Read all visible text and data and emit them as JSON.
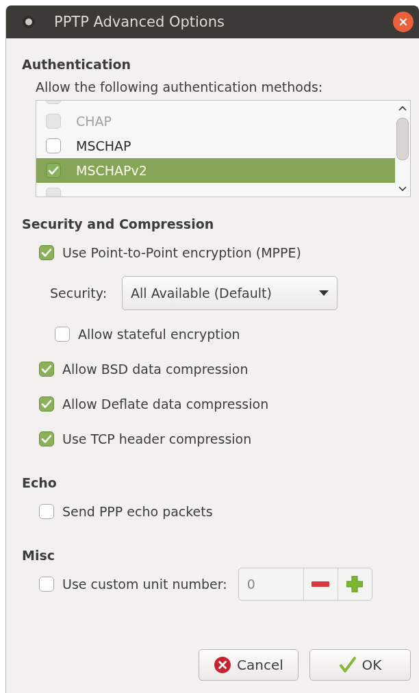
{
  "window": {
    "title": "PPTP Advanced Options"
  },
  "authentication": {
    "heading": "Authentication",
    "prompt": "Allow the following authentication methods:",
    "methods": [
      {
        "checked": false,
        "disabled": true,
        "selected": false
      },
      {
        "label": "CHAP",
        "checked": false,
        "disabled": true,
        "selected": false
      },
      {
        "label": "MSCHAP",
        "checked": false,
        "disabled": false,
        "selected": false
      },
      {
        "label": "MSCHAPv2",
        "checked": true,
        "disabled": false,
        "selected": true
      },
      {
        "checked": false,
        "disabled": true,
        "selected": false
      }
    ]
  },
  "sections": [
    {
      "heading": "Security and Compression",
      "items": [
        {
          "kind": "checkbox",
          "label": "Use Point-to-Point encryption (MPPE)",
          "checked": true,
          "children": [
            {
              "kind": "dropdown",
              "label": "Security:",
              "value": "All Available (Default)"
            },
            {
              "kind": "checkbox",
              "label": "Allow stateful encryption",
              "checked": false
            }
          ]
        },
        {
          "kind": "checkbox",
          "label": "Allow BSD data compression",
          "checked": true
        },
        {
          "kind": "checkbox",
          "label": "Allow Deflate data compression",
          "checked": true
        },
        {
          "kind": "checkbox",
          "label": "Use TCP header compression",
          "checked": true
        }
      ]
    },
    {
      "heading": "Echo",
      "items": [
        {
          "kind": "checkbox",
          "label": "Send PPP echo packets",
          "checked": false
        }
      ]
    },
    {
      "heading": "Misc",
      "items": [
        {
          "kind": "spin",
          "label": "Use custom unit number:",
          "checked": false,
          "value": "0"
        }
      ]
    }
  ],
  "buttons": [
    {
      "kind": "cancel",
      "label": "Cancel"
    },
    {
      "kind": "ok",
      "label": "OK"
    }
  ]
}
